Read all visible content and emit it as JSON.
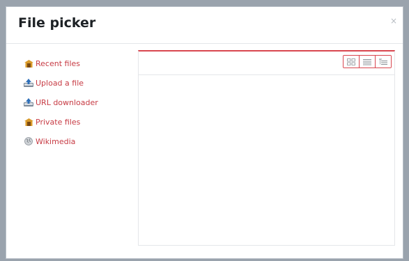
{
  "dialog": {
    "title": "File picker",
    "close_glyph": "×"
  },
  "sidebar": {
    "items": [
      {
        "label": "Recent files",
        "icon": "recent-files-icon"
      },
      {
        "label": "Upload a file",
        "icon": "upload-icon"
      },
      {
        "label": "URL downloader",
        "icon": "url-downloader-icon"
      },
      {
        "label": "Private files",
        "icon": "private-files-icon"
      },
      {
        "label": "Wikimedia",
        "icon": "wikimedia-icon"
      }
    ]
  },
  "toolbar": {
    "view_buttons": [
      "icons-view",
      "list-view",
      "tree-view"
    ]
  },
  "colors": {
    "accent": "#d8464f",
    "link": "#c73b44"
  }
}
